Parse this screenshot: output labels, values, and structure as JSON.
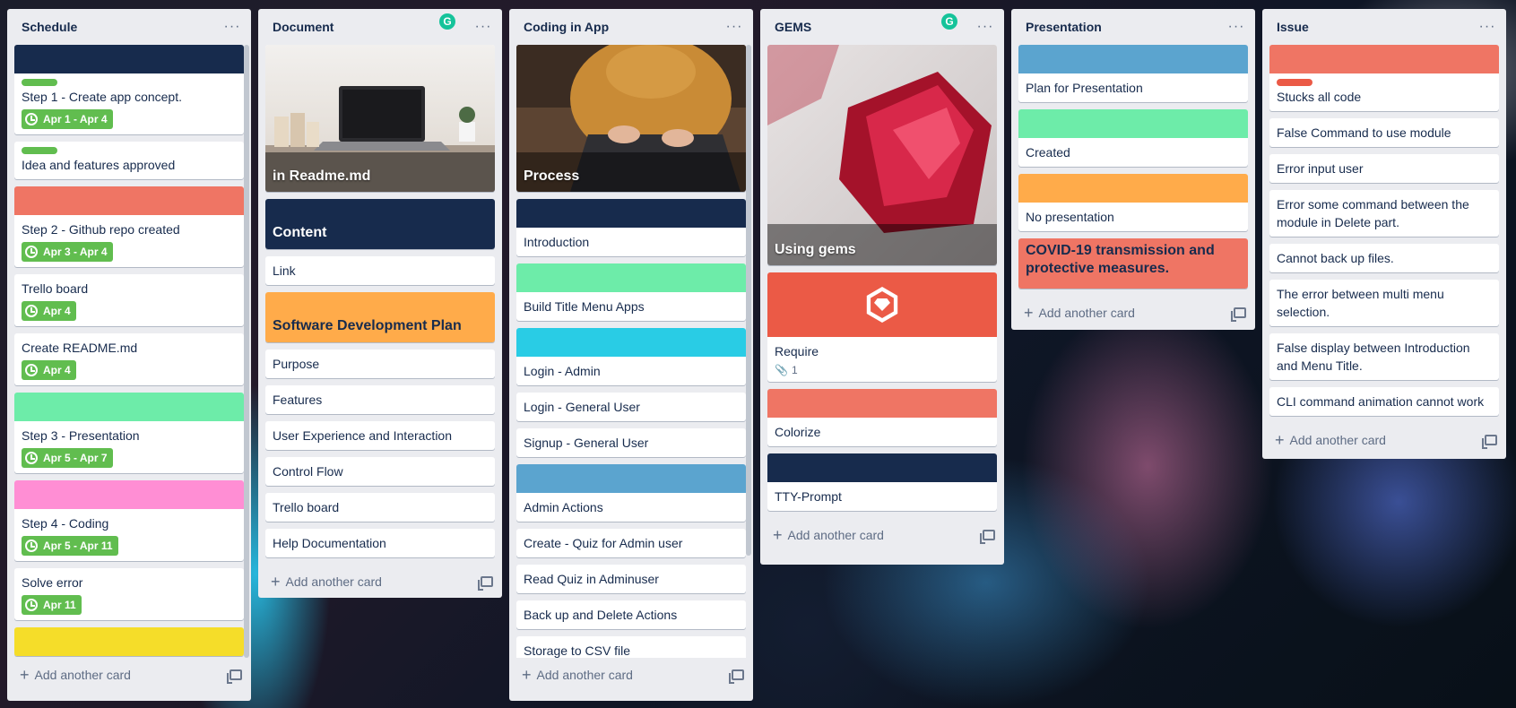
{
  "lists": {
    "schedule": {
      "title": "Schedule",
      "menu": "···",
      "add": "Add another card",
      "cards": {
        "c1": {
          "title": "Step 1 - Create app concept.",
          "due": "Apr 1 - Apr 4",
          "cover": "#172b4d",
          "label": "#61bd4f"
        },
        "c2": {
          "title": "Idea and features approved",
          "label": "#61bd4f"
        },
        "c3": {
          "title": "Step 2 - Github repo created",
          "due": "Apr 3 - Apr 4",
          "cover": "#ef7564"
        },
        "c4": {
          "title": "Trello board",
          "due": "Apr 4"
        },
        "c5": {
          "title": "Create README.md",
          "due": "Apr 4"
        },
        "c6": {
          "title": "Step 3 - Presentation",
          "due": "Apr 5 - Apr 7",
          "cover": "#6deca9"
        },
        "c7": {
          "title": "Step 4 - Coding",
          "due": "Apr 5 - Apr 11",
          "cover": "#ff8ed4"
        },
        "c8": {
          "title": "Solve error",
          "due": "Apr 11"
        },
        "c9": {
          "cover": "#f5dd29"
        }
      }
    },
    "document": {
      "title": "Document",
      "menu": "···",
      "add": "Add another card",
      "cards": {
        "c1": {
          "title": "in Readme.md"
        },
        "c2": {
          "title": "Content",
          "cover": "#172b4d"
        },
        "c3": {
          "title": "Link"
        },
        "c4": {
          "title": "Software Development Plan",
          "cover": "#ffab4a"
        },
        "c5": {
          "title": "Purpose"
        },
        "c6": {
          "title": "Features"
        },
        "c7": {
          "title": "User Experience and Interaction"
        },
        "c8": {
          "title": "Control Flow"
        },
        "c9": {
          "title": "Trello board"
        },
        "c10": {
          "title": "Help Documentation"
        }
      }
    },
    "coding": {
      "title": "Coding in App",
      "menu": "···",
      "add": "Add another card",
      "cards": {
        "c1": {
          "title": "Process"
        },
        "c2": {
          "title": "Introduction",
          "cover": "#172b4d"
        },
        "c3": {
          "title": "Build Title Menu Apps",
          "cover": "#6deca9"
        },
        "c4": {
          "title": "Login - Admin",
          "cover": "#29cce5"
        },
        "c5": {
          "title": "Login - General User"
        },
        "c6": {
          "title": "Signup - General User"
        },
        "c7": {
          "title": "Admin Actions",
          "cover": "#5ba4cf"
        },
        "c8": {
          "title": "Create - Quiz for Admin user"
        },
        "c9": {
          "title": "Read Quiz in Adminuser"
        },
        "c10": {
          "title": "Back up and Delete Actions"
        },
        "c11": {
          "title": "Storage to CSV file"
        }
      }
    },
    "gems": {
      "title": "GEMS",
      "menu": "···",
      "add": "Add another card",
      "cards": {
        "c1": {
          "title": "Using gems"
        },
        "c2": {
          "title": "Require",
          "attachments": "1",
          "cover": "#eb5a46"
        },
        "c3": {
          "title": "Colorize",
          "cover": "#ef7564"
        },
        "c4": {
          "title": "TTY-Prompt",
          "cover": "#172b4d"
        }
      }
    },
    "presentation": {
      "title": "Presentation",
      "menu": "···",
      "add": "Add another card",
      "cards": {
        "c1": {
          "title": "Plan for Presentation",
          "cover": "#5ba4cf"
        },
        "c2": {
          "title": "Created",
          "cover": "#6deca9"
        },
        "c3": {
          "title": "No presentation",
          "cover": "#ffab4a"
        },
        "c4": {
          "title": "COVID-19 transmission and protective measures.",
          "cover": "#ef7564"
        }
      }
    },
    "issue": {
      "title": "Issue",
      "menu": "···",
      "add": "Add another card",
      "cards": {
        "c1": {
          "title": "Stucks all code",
          "cover": "#ef7564",
          "label": "#eb5a46"
        },
        "c2": {
          "title": "False Command to use module"
        },
        "c3": {
          "title": "Error input user"
        },
        "c4": {
          "title": "Error some command between the module in Delete part."
        },
        "c5": {
          "title": "Cannot back up files."
        },
        "c6": {
          "title": "The error between multi menu selection."
        },
        "c7": {
          "title": "False display between Introduction and Menu Title."
        },
        "c8": {
          "title": "CLI command animation cannot work"
        }
      }
    }
  },
  "icons": {
    "grammarly": "G",
    "plus": "+",
    "attachment": "paperclip-icon",
    "clock": "clock-icon",
    "template": "card-template-icon"
  }
}
